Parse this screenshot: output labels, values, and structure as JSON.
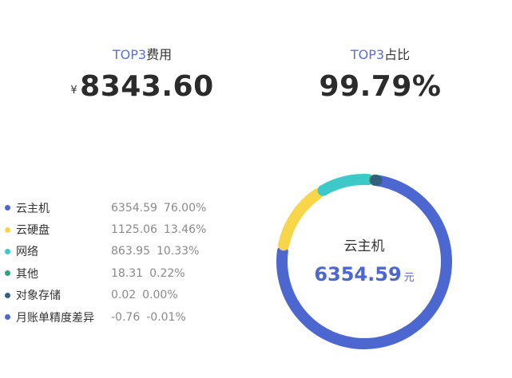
{
  "kpis": {
    "top3_cost": {
      "label_prefix": "TOP3",
      "label_suffix": "费用",
      "currency": "¥",
      "value": "8343.60"
    },
    "top3_share": {
      "label_prefix": "TOP3",
      "label_suffix": "占比",
      "value": "99.79%"
    }
  },
  "legend": {
    "items": [
      {
        "name": "云主机",
        "value": "6354.59",
        "percent": "76.00%",
        "color": "#4d67d1"
      },
      {
        "name": "云硬盘",
        "value": "1125.06",
        "percent": "13.46%",
        "color": "#f7d64a"
      },
      {
        "name": "网络",
        "value": "863.95",
        "percent": "10.33%",
        "color": "#3ec9c9"
      },
      {
        "name": "其他",
        "value": "18.31",
        "percent": "0.22%",
        "color": "#2ea37e"
      },
      {
        "name": "对象存储",
        "value": "0.02",
        "percent": "0.00%",
        "color": "#33617c"
      },
      {
        "name": "月账单精度差异",
        "value": "-0.76",
        "percent": "-0.01%",
        "color": "#4d67d1"
      }
    ]
  },
  "center": {
    "name": "云主机",
    "value": "6354.59",
    "unit": "元"
  },
  "chart_data": {
    "type": "pie",
    "categories": [
      "云主机",
      "云硬盘",
      "网络",
      "其他",
      "对象存储",
      "月账单精度差异"
    ],
    "values": [
      6354.59,
      1125.06,
      863.95,
      18.31,
      0.02,
      -0.76
    ],
    "percents": [
      76.0,
      13.46,
      10.33,
      0.22,
      0.0,
      -0.01
    ],
    "colors": [
      "#4d67d1",
      "#f7d64a",
      "#3ec9c9",
      "#2ea37e",
      "#33617c",
      "#4d67d1"
    ],
    "donut": true,
    "legend_position": "left"
  }
}
